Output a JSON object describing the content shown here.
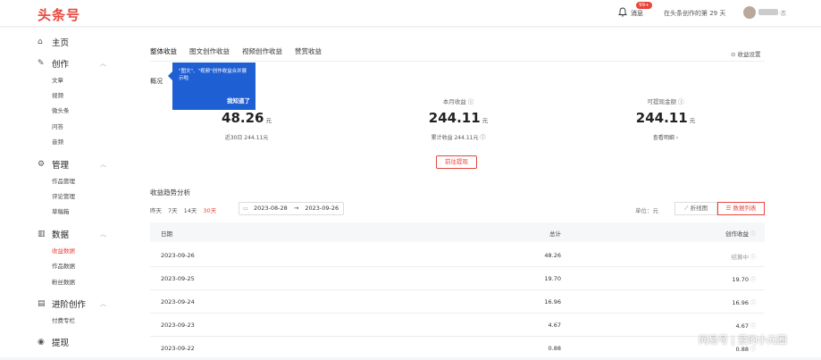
{
  "header": {
    "logo": "头条号",
    "messages_label": "消息",
    "messages_badge": "99+",
    "days_text": "在头条创作的第 29 天",
    "user_suffix": "·恋"
  },
  "sidebar": {
    "home": "主页",
    "create": {
      "label": "创作",
      "items": [
        "文章",
        "视频",
        "微头条",
        "问答",
        "音频"
      ]
    },
    "manage": {
      "label": "管理",
      "items": [
        "作品管理",
        "评论管理",
        "草稿箱"
      ]
    },
    "data": {
      "label": "数据",
      "items": [
        "收益数据",
        "作品数据",
        "粉丝数据"
      ]
    },
    "advanced": {
      "label": "进阶创作",
      "items": [
        "付费专栏"
      ]
    },
    "withdraw": "提现"
  },
  "tabs": [
    "整体收益",
    "图文创作收益",
    "视频创作收益",
    "赞赏收益"
  ],
  "settings_label": "收益设置",
  "overview_title": "概况",
  "tooltip": {
    "text": "\"图文\"、\"视频\"创作收益合并展示啦",
    "button": "我知道了"
  },
  "stats": [
    {
      "label": "",
      "value": "48.26",
      "unit": "元",
      "sub": "近30日 244.11元"
    },
    {
      "label": "本月收益",
      "value": "244.11",
      "unit": "元",
      "sub": "累计收益 244.11元"
    },
    {
      "label": "可提现金额",
      "value": "244.11",
      "unit": "元",
      "sub": "查看明细"
    }
  ],
  "withdraw_button": "前往提现",
  "trend": {
    "title": "收益趋势分析",
    "ranges": [
      "昨天",
      "7天",
      "14天",
      "30天"
    ],
    "date_from": "2023-08-28",
    "date_sep": "→",
    "date_to": "2023-09-26",
    "unit_label": "单位：元",
    "view_chart": "折线图",
    "view_table": "数据列表"
  },
  "table": {
    "headers": {
      "date": "日期",
      "total": "总计",
      "create": "创作收益"
    },
    "rows": [
      {
        "date": "2023-09-26",
        "total": "48.26",
        "create": "结算中"
      },
      {
        "date": "2023-09-25",
        "total": "19.70",
        "create": "19.70"
      },
      {
        "date": "2023-09-24",
        "total": "16.96",
        "create": "16.96"
      },
      {
        "date": "2023-09-23",
        "total": "4.67",
        "create": "4.67"
      },
      {
        "date": "2023-09-22",
        "total": "0.88",
        "create": "0.88"
      }
    ]
  },
  "watermark": "网易号 | 爱的小元圈",
  "colors": {
    "brand_red": "#e8453c",
    "tooltip_blue": "#1f5fd4"
  }
}
